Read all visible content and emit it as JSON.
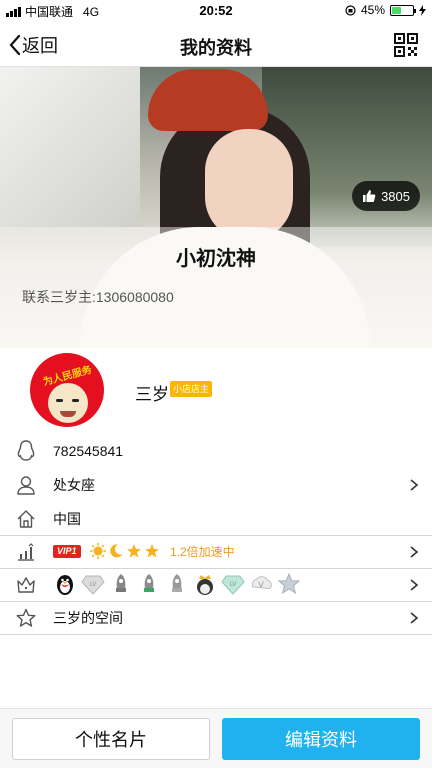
{
  "status_bar": {
    "carrier": "中国联通",
    "network": "4G",
    "time": "20:52",
    "battery_percent": "45%",
    "battery_level": 0.45
  },
  "nav": {
    "back_label": "返回",
    "title": "我的资料",
    "qr_icon": "qr-code-icon"
  },
  "hero": {
    "likes": "3805",
    "name": "小初沈神",
    "contact": "联系三岁主:1306080080"
  },
  "profile": {
    "avatar_text": "为人民服务",
    "nickname": "三岁",
    "shop_badge": "小店店主"
  },
  "rows": {
    "qq_number": "782545841",
    "zodiac": "处女座",
    "region": "中国",
    "vip_tag": "VIP1",
    "vip_speed": "1.2倍加速中",
    "space": "三岁的空间"
  },
  "medals": [
    "penguin",
    "diamond-gray",
    "rocket-gray",
    "rocket-green",
    "rocket-gray-2",
    "crown-penguin",
    "diamond-teal",
    "v-badge",
    "star-badge"
  ],
  "bottom": {
    "card_label": "个性名片",
    "edit_label": "编辑资料"
  },
  "colors": {
    "accent": "#1fb2ef",
    "vip_red": "#e0251c",
    "vip_orange": "#f09a1a",
    "shop_badge": "#ffb400"
  }
}
